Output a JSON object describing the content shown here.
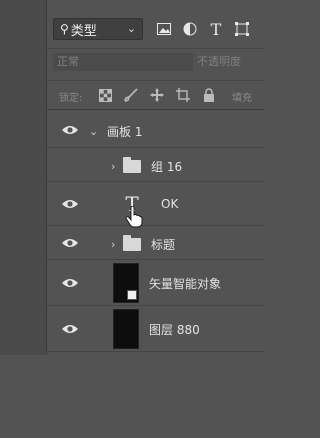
{
  "filter": {
    "kind_label": "类型",
    "icons": [
      "image-filter-icon",
      "adjustment-filter-icon",
      "type-filter-icon",
      "shape-filter-icon"
    ]
  },
  "blend": {
    "mode": "正常",
    "opacity_label": "不透明度"
  },
  "lock": {
    "label": "锁定:",
    "fill_label": "填充",
    "icons": [
      "lock-transparent-icon",
      "lock-paint-icon",
      "lock-move-icon",
      "lock-artboard-icon",
      "lock-all-icon"
    ]
  },
  "layers": [
    {
      "name": "画板 1",
      "kind": "artboard",
      "visible": true,
      "expanded": true
    },
    {
      "name": "组 16",
      "kind": "group",
      "visible": false,
      "expanded": false
    },
    {
      "name": "OK",
      "kind": "text",
      "visible": true
    },
    {
      "name": "标题",
      "kind": "group",
      "visible": true,
      "expanded": false
    },
    {
      "name": "矢量智能对象",
      "kind": "smart-object",
      "visible": true
    },
    {
      "name": "图层 880",
      "kind": "pixel",
      "visible": true
    }
  ],
  "colors": {
    "panel_bg": "#535353",
    "text": "#e4e4e4"
  }
}
